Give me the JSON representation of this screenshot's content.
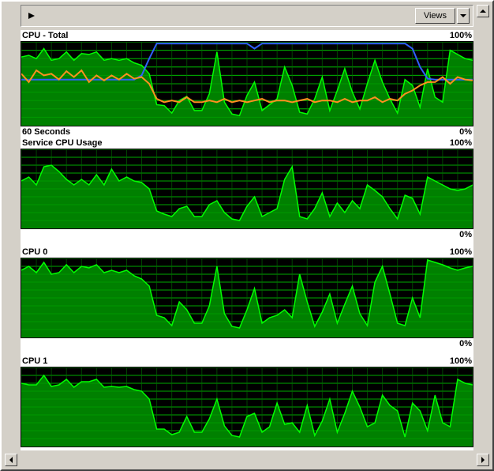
{
  "toolbar": {
    "views_label": "Views"
  },
  "labels": {
    "max": "100%",
    "min": "0%",
    "duration": "60 Seconds"
  },
  "chart_data": [
    {
      "type": "area",
      "title": "CPU - Total",
      "x_range": [
        0,
        60
      ],
      "ylim": [
        0,
        100
      ],
      "ylabel": "%",
      "xlabel": "60 Seconds",
      "series": [
        {
          "name": "CPU Total",
          "kind": "area",
          "color": "#00ff00",
          "values": [
            82,
            84,
            80,
            92,
            78,
            80,
            88,
            78,
            86,
            85,
            88,
            78,
            80,
            78,
            80,
            75,
            72,
            62,
            25,
            24,
            15,
            30,
            35,
            18,
            18,
            38,
            88,
            28,
            14,
            12,
            36,
            52,
            18,
            25,
            32,
            70,
            48,
            16,
            14,
            32,
            58,
            18,
            42,
            68,
            40,
            20,
            50,
            78,
            52,
            32,
            15,
            55,
            48,
            22,
            68,
            34,
            28,
            90,
            85,
            80,
            78
          ]
        },
        {
          "name": "Blue line",
          "kind": "line",
          "color": "#3060ff",
          "values": [
            55,
            55,
            55,
            55,
            55,
            55,
            55,
            55,
            55,
            55,
            55,
            55,
            55,
            55,
            55,
            55,
            60,
            80,
            98,
            98,
            98,
            98,
            98,
            98,
            98,
            98,
            98,
            98,
            98,
            98,
            98,
            92,
            98,
            98,
            98,
            98,
            98,
            98,
            98,
            98,
            98,
            98,
            98,
            98,
            98,
            98,
            98,
            98,
            98,
            98,
            98,
            98,
            92,
            70,
            56,
            55,
            55,
            55,
            55,
            55,
            55
          ]
        },
        {
          "name": "Orange line",
          "kind": "line",
          "color": "#ff9020",
          "values": [
            62,
            52,
            66,
            60,
            62,
            55,
            65,
            58,
            66,
            52,
            60,
            54,
            60,
            55,
            62,
            56,
            58,
            50,
            32,
            28,
            30,
            28,
            34,
            28,
            28,
            30,
            28,
            32,
            28,
            30,
            28,
            30,
            32,
            28,
            30,
            30,
            28,
            30,
            32,
            28,
            30,
            30,
            28,
            32,
            28,
            30,
            30,
            34,
            28,
            32,
            30,
            38,
            42,
            48,
            52,
            52,
            58,
            50,
            58,
            55,
            54
          ]
        }
      ]
    },
    {
      "type": "area",
      "title": "Service CPU Usage",
      "x_range": [
        0,
        60
      ],
      "ylim": [
        0,
        100
      ],
      "ylabel": "%",
      "series": [
        {
          "name": "Service CPU",
          "kind": "area",
          "color": "#00ff00",
          "values": [
            60,
            65,
            55,
            78,
            80,
            72,
            62,
            55,
            62,
            55,
            68,
            55,
            75,
            60,
            65,
            60,
            58,
            50,
            22,
            18,
            15,
            25,
            28,
            15,
            15,
            30,
            35,
            20,
            12,
            10,
            28,
            40,
            15,
            20,
            25,
            62,
            78,
            15,
            12,
            25,
            45,
            15,
            32,
            20,
            35,
            25,
            55,
            48,
            40,
            25,
            12,
            42,
            38,
            18,
            65,
            60,
            55,
            50,
            48,
            50,
            55
          ]
        }
      ]
    },
    {
      "type": "area",
      "title": "CPU 0",
      "x_range": [
        0,
        60
      ],
      "ylim": [
        0,
        100
      ],
      "ylabel": "%",
      "series": [
        {
          "name": "CPU 0",
          "kind": "area",
          "color": "#00ff00",
          "values": [
            85,
            90,
            82,
            95,
            80,
            82,
            92,
            82,
            90,
            88,
            92,
            82,
            85,
            82,
            85,
            78,
            74,
            65,
            28,
            25,
            15,
            45,
            35,
            18,
            18,
            40,
            90,
            30,
            14,
            12,
            35,
            62,
            18,
            25,
            28,
            35,
            25,
            80,
            45,
            14,
            32,
            55,
            18,
            42,
            65,
            30,
            15,
            70,
            90,
            55,
            18,
            15,
            50,
            25,
            98,
            95,
            92,
            88,
            85,
            88,
            90
          ]
        }
      ]
    },
    {
      "type": "area",
      "title": "CPU 1",
      "x_range": [
        0,
        60
      ],
      "ylim": [
        0,
        100
      ],
      "ylabel": "%",
      "series": [
        {
          "name": "CPU 1",
          "kind": "area",
          "color": "#00ff00",
          "values": [
            80,
            78,
            78,
            90,
            76,
            78,
            85,
            75,
            82,
            82,
            85,
            75,
            76,
            75,
            76,
            72,
            70,
            60,
            22,
            22,
            15,
            18,
            38,
            18,
            18,
            35,
            60,
            26,
            14,
            12,
            38,
            42,
            18,
            25,
            55,
            28,
            30,
            18,
            52,
            14,
            32,
            60,
            18,
            42,
            70,
            50,
            25,
            30,
            65,
            52,
            45,
            12,
            55,
            45,
            20,
            65,
            30,
            25,
            85,
            80,
            78
          ]
        }
      ]
    }
  ],
  "colors": {
    "grid_dark": "#004400",
    "grid_light": "#00aa00",
    "fill": "#008000",
    "area_line": "#00ff00",
    "bg": "#000000"
  }
}
